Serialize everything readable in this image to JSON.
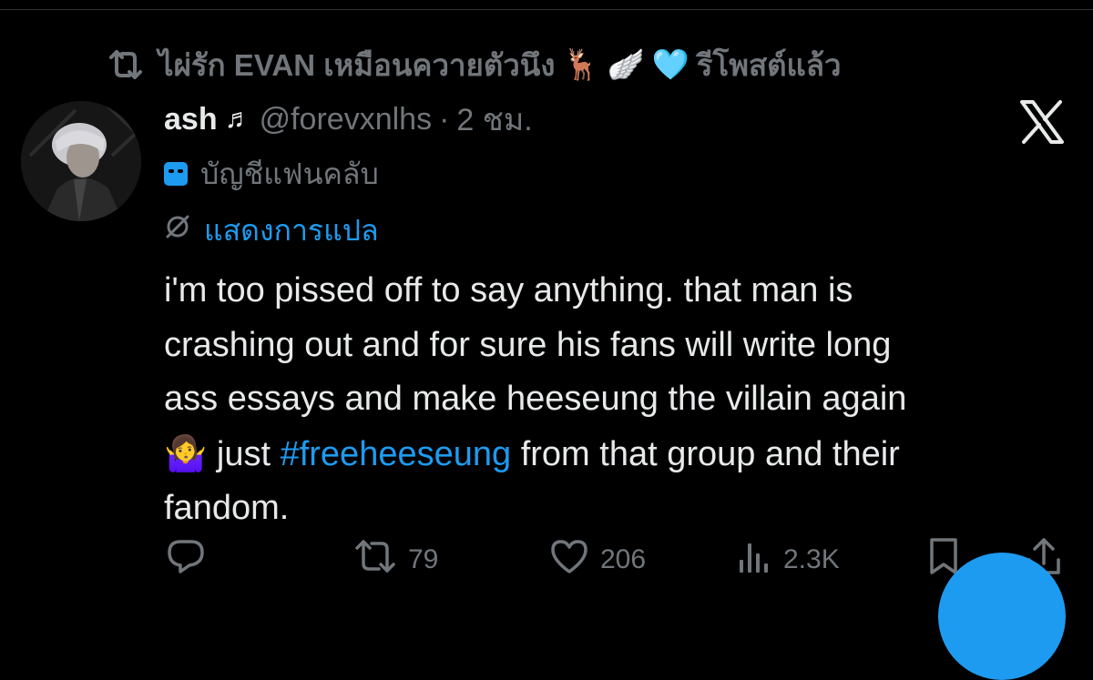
{
  "repost_banner": {
    "text": "ไผ่รัก EVAN เหมือนควายตัวนึง",
    "emojis": [
      "🦌",
      "🪽",
      "🩵"
    ],
    "suffix": "รีโพสต์แล้ว"
  },
  "tweet": {
    "author": {
      "name": "ash",
      "name_note": "♬",
      "handle": "@forevxnlhs",
      "time": "2 ชม.",
      "fan_label": "บัญชีแฟนคลับ"
    },
    "translate_label": "แสดงการแปล",
    "lines": [
      "i'm too pissed off to say anything. that man is",
      "crashing out and for sure his fans will write long",
      "ass essays and make heeseung the villain again"
    ],
    "line4": {
      "emoji": "🤷‍♀️",
      "before": " just ",
      "hashtag": "#freeheeseung",
      "after": " from that group and their"
    },
    "line5": "fandom."
  },
  "actions": {
    "retweets": "79",
    "likes": "206",
    "views": "2.3K"
  },
  "colors": {
    "background": "#000000",
    "text": "#e7e9ea",
    "muted": "#71767b",
    "accent": "#1d9bf0"
  },
  "icons": [
    "retweet-icon",
    "x-logo-icon",
    "masks-icon",
    "translate-icon",
    "reply-icon",
    "like-icon",
    "views-icon",
    "bookmark-icon",
    "share-icon"
  ]
}
